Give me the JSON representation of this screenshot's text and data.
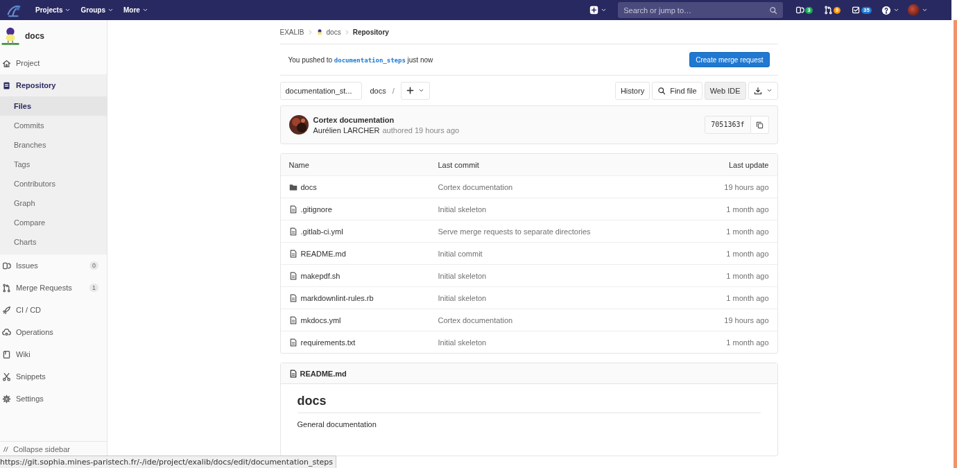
{
  "top_nav": {
    "menus": [
      "Projects",
      "Groups",
      "More"
    ],
    "search": {
      "placeholder": "Search or jump to…"
    },
    "counters": [
      {
        "kind": "issues",
        "value": "3",
        "color": "#1aaa55"
      },
      {
        "kind": "merge",
        "value": "9",
        "color": "#fc9403"
      },
      {
        "kind": "todo",
        "value": "35",
        "color": "#1f78d1"
      }
    ]
  },
  "sidebar": {
    "project_name": "docs",
    "items": [
      {
        "kind": "home",
        "label": "Project",
        "selected": false
      },
      {
        "kind": "repo",
        "label": "Repository",
        "selected": true,
        "children": [
          {
            "label": "Files",
            "selected": true
          },
          {
            "label": "Commits",
            "selected": false
          },
          {
            "label": "Branches",
            "selected": false
          },
          {
            "label": "Tags",
            "selected": false
          },
          {
            "label": "Contributors",
            "selected": false
          },
          {
            "label": "Graph",
            "selected": false
          },
          {
            "label": "Compare",
            "selected": false
          },
          {
            "label": "Charts",
            "selected": false
          }
        ]
      },
      {
        "kind": "issues",
        "label": "Issues",
        "selected": false,
        "badge": "0"
      },
      {
        "kind": "merge",
        "label": "Merge Requests",
        "selected": false,
        "badge": "1"
      },
      {
        "kind": "rocket",
        "label": "CI / CD",
        "selected": false
      },
      {
        "kind": "cloud",
        "label": "Operations",
        "selected": false
      },
      {
        "kind": "book",
        "label": "Wiki",
        "selected": false
      },
      {
        "kind": "scissors",
        "label": "Snippets",
        "selected": false
      },
      {
        "kind": "gear",
        "label": "Settings",
        "selected": false
      }
    ],
    "collapse": "Collapse sidebar"
  },
  "breadcrumb": [
    {
      "label": "EXALIB",
      "current": false
    },
    {
      "label": "docs",
      "current": false
    },
    {
      "label": "Repository",
      "current": true
    }
  ],
  "push_notice": {
    "prefix": "You pushed to",
    "branch": "documentation_steps",
    "suffix": "just now",
    "button": "Create merge request"
  },
  "toolbar": {
    "branch": "documentation_st...",
    "path": "docs",
    "separator": "/",
    "buttons": [
      {
        "kind": "text",
        "label": "History",
        "hovered": false
      },
      {
        "kind": "search",
        "label": "Find file",
        "hovered": false
      },
      {
        "kind": "text",
        "label": "Web IDE",
        "hovered": true
      }
    ]
  },
  "commit": {
    "title": "Cortex documentation",
    "author": "Aurélien LARCHER",
    "meta": "authored 19 hours ago",
    "sha": "7051363f"
  },
  "table": {
    "columns": [
      "Name",
      "Last commit",
      "Last update"
    ],
    "rows": [
      {
        "kind": "folder",
        "name": "docs",
        "commit": "Cortex documentation",
        "updated": "19 hours ago"
      },
      {
        "kind": "file",
        "name": ".gitignore",
        "commit": "Initial skeleton",
        "updated": "1 month ago"
      },
      {
        "kind": "file",
        "name": ".gitlab-ci.yml",
        "commit": "Serve merge requests to separate directories",
        "updated": "1 month ago"
      },
      {
        "kind": "file",
        "name": "README.md",
        "commit": "Initial commit",
        "updated": "1 month ago"
      },
      {
        "kind": "file",
        "name": "makepdf.sh",
        "commit": "Initial skeleton",
        "updated": "1 month ago"
      },
      {
        "kind": "file",
        "name": "markdownlint-rules.rb",
        "commit": "Initial skeleton",
        "updated": "1 month ago"
      },
      {
        "kind": "file",
        "name": "mkdocs.yml",
        "commit": "Cortex documentation",
        "updated": "19 hours ago"
      },
      {
        "kind": "file",
        "name": "requirements.txt",
        "commit": "Initial skeleton",
        "updated": "1 month ago"
      }
    ]
  },
  "readme": {
    "filename": "README.md",
    "heading": "docs",
    "body": "General documentation"
  },
  "status_url": "https://git.sophia.mines-paristech.fr/-/ide/project/exalib/docs/edit/documentation_steps"
}
